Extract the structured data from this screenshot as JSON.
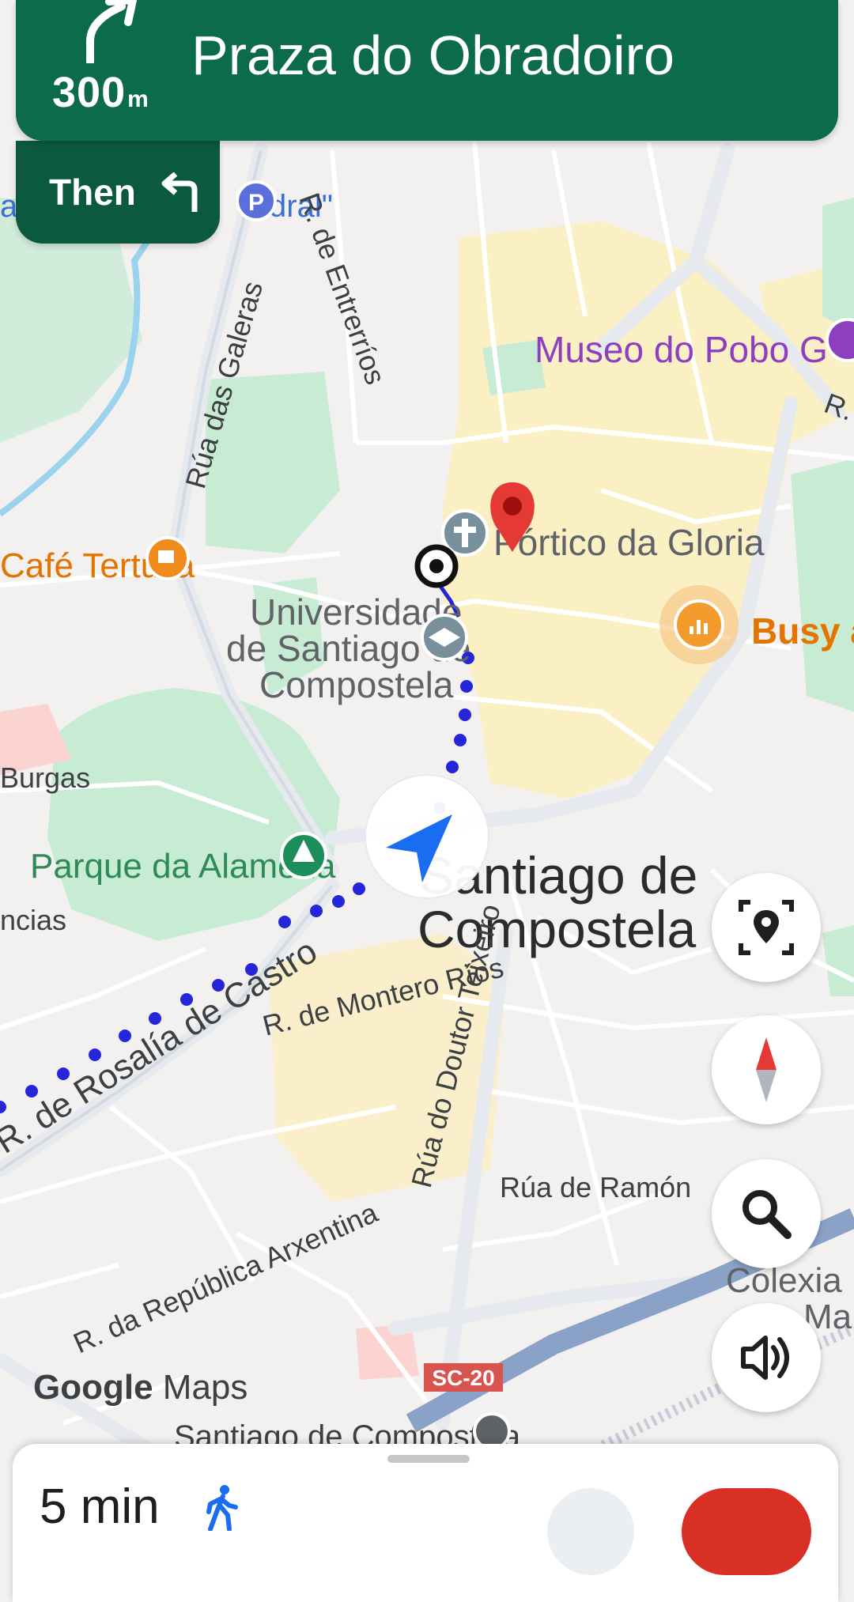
{
  "navigation": {
    "distance_value": "300",
    "distance_unit": "m",
    "street": "Praza do Obradoiro",
    "then_label": "Then",
    "next_turn_icon": "turn-left-icon",
    "primary_turn_icon": "turn-slight-right-icon"
  },
  "map": {
    "city_label_line1": "Santiago de",
    "city_label_line2": "Compostela",
    "destination_label": "Pórtico da Gloria",
    "university_label_line1": "Universidade",
    "university_label_line2": "de Santiago de",
    "university_label_line3": "Compostela",
    "museum_label": "Museo do Pobo G",
    "busy_label": "Busy a",
    "cafe_label": "Café Tertulia",
    "park_label": "Parque da Alameda",
    "street_galeras": "Rúa das Galeras",
    "street_entrerrios": "R. de Entrerríos",
    "street_montero": "R. de Montero Ríos",
    "street_doutor": "Rúa do Doutor Teixeiro",
    "street_rosalia": "R. de Rosalía de Castro",
    "street_arxentina": "R. da República Arxentina",
    "street_ramon": "Rúa de Ramón",
    "street_r_right": "R.",
    "burgas_label": "Burgas",
    "ncias_label": "ncias",
    "parking_label": "dral\"",
    "left_edge_label": "ar",
    "colexia_line1": "Colexia",
    "colexia_line2": "Ma",
    "station_label": "Santiago de Compostela",
    "road_shield": "SC-20",
    "colors": {
      "route": "#1a1ad6",
      "destination_pin": "#e53935",
      "park": "#c8ebd4",
      "old_town": "#fbefc4",
      "nav_green": "#0b6b4c"
    }
  },
  "controls": {
    "recenter_icon": "recenter-location-icon",
    "compass_icon": "compass-icon",
    "search_icon": "search-icon",
    "volume_icon": "volume-icon"
  },
  "branding": {
    "logo_google": "Google",
    "logo_maps": "Maps"
  },
  "bottom_sheet": {
    "eta": "5 min",
    "mode_icon": "walking-icon"
  }
}
